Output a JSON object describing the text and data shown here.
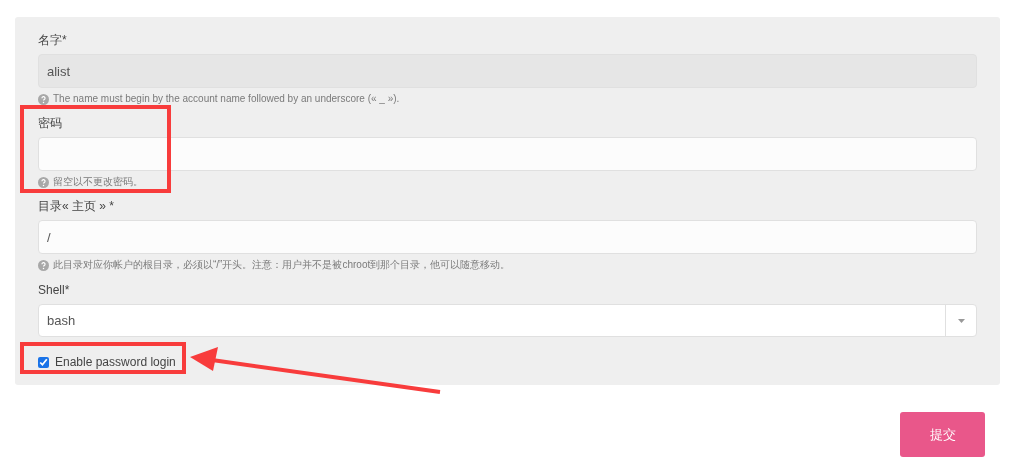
{
  "fields": [
    {
      "kind": "text",
      "label": "名字*",
      "value": "alist",
      "disabled": true,
      "help": "The name must begin by the account name followed by an underscore (« _ »)."
    },
    {
      "kind": "text",
      "label": "密码",
      "disabled": false,
      "help": "留空以不更改密码。"
    },
    {
      "kind": "text",
      "label": "目录« 主页 » *",
      "value": "/",
      "disabled": false,
      "help": "此目录对应你帐户的根目录，必须以“/”开头。注意：用户并不是被chroot到那个目录，他可以随意移动。"
    },
    {
      "kind": "select",
      "label": "Shell*",
      "value": "bash"
    },
    {
      "kind": "checkbox",
      "label": "Enable password login",
      "checked": true
    }
  ],
  "submit": "提交"
}
